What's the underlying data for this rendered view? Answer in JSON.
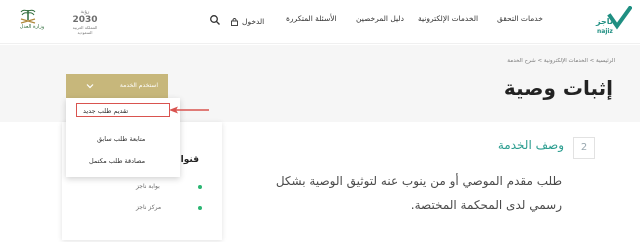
{
  "header": {
    "logo_ar": "ناجز",
    "logo_en": "najiz",
    "nav": [
      {
        "label": "خدمات التحقق"
      },
      {
        "label": "الخدمات الإلكترونية"
      },
      {
        "label": "دليل المرخصين"
      },
      {
        "label": "الأسئلة المتكررة"
      },
      {
        "label": "الدخول"
      }
    ],
    "vision": {
      "top": "رؤية",
      "year": "2030",
      "bottom": "المملكة العربية السعودية"
    },
    "emblem_text": "وزارة العدل"
  },
  "breadcrumb": "الرئيسية > الخدمات الإلكترونية > شرح الخدمة",
  "page_title": "إثبات وصية",
  "use_service_button": "استخدم الخدمة",
  "dropdown": {
    "items": [
      {
        "label": "تقديم طلب جديد"
      },
      {
        "label": "متابعة طلب سابق"
      },
      {
        "label": "مصادقة طلب مكتمل"
      }
    ]
  },
  "section": {
    "number": "2",
    "title": "وصف الخدمة",
    "line1": "طلب مقدم الموصي أو من ينوب عنه لتوثيق الوصية بشكل",
    "line2": "رسمي لدى المحكمة المختصة."
  },
  "channels": {
    "title": "قنوات تقديم",
    "items": [
      {
        "label": "بوابة ناجز"
      },
      {
        "label": "مركز ناجز"
      }
    ]
  },
  "colors": {
    "brand": "#1f8f82",
    "accent_gold": "#c7b77b",
    "highlight_red": "#d9534f",
    "dot_green": "#2bb673"
  }
}
